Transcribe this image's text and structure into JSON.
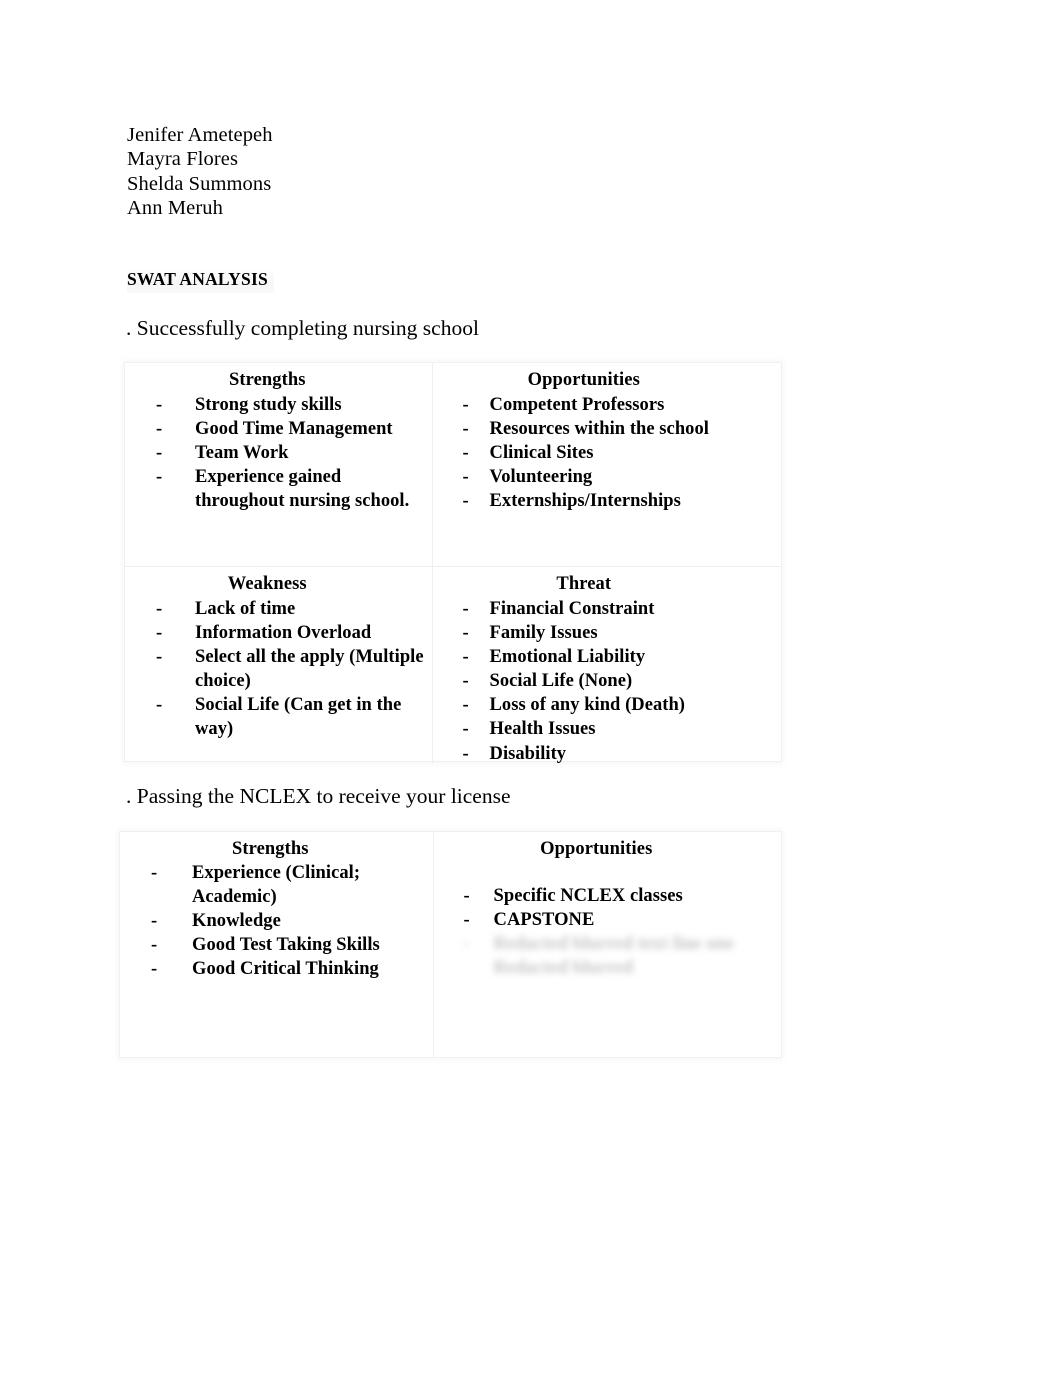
{
  "document": {
    "authors": [
      "Jenifer Ametepeh",
      "Mayra Flores",
      "Shelda Summons",
      "Ann Meruh"
    ],
    "heading": "SWAT ANALYSIS"
  },
  "sections": [
    {
      "title": ". Successfully completing nursing school",
      "table": {
        "row1": {
          "left": {
            "title": "Strengths",
            "items": [
              "Strong study skills",
              "Good Time Management",
              "Team Work",
              "Experience gained throughout nursing school."
            ]
          },
          "right": {
            "title": "Opportunities",
            "items": [
              "Competent Professors",
              "Resources within the school",
              "Clinical Sites",
              "Volunteering",
              "Externships/Internships"
            ]
          }
        },
        "row2": {
          "left": {
            "title": "Weakness",
            "items": [
              "Lack of time",
              " Information Overload",
              "Select all the apply (Multiple choice)",
              "Social Life (Can get in the way)"
            ]
          },
          "right": {
            "title": "Threat",
            "items": [
              "Financial Constraint",
              "Family Issues",
              "Emotional Liability",
              "Social Life (None)",
              "Loss of any kind (Death)",
              "Health Issues",
              "Disability"
            ]
          }
        }
      }
    },
    {
      "title": ". Passing the NCLEX to receive your license",
      "table": {
        "row1": {
          "left": {
            "title": "Strengths",
            "items": [
              "Experience (Clinical; Academic)",
              "Knowledge",
              "Good Test Taking Skills",
              "Good Critical Thinking"
            ]
          },
          "right": {
            "title": "Opportunities",
            "items": [
              "Specific NCLEX classes",
              "CAPSTONE"
            ],
            "redacted_items": [
              "Redacted blurred text line one",
              "Redacted blurred"
            ]
          }
        }
      }
    }
  ],
  "colors": {
    "text": "#000000",
    "table_border": "#efefef",
    "page_background": "#ffffff"
  }
}
